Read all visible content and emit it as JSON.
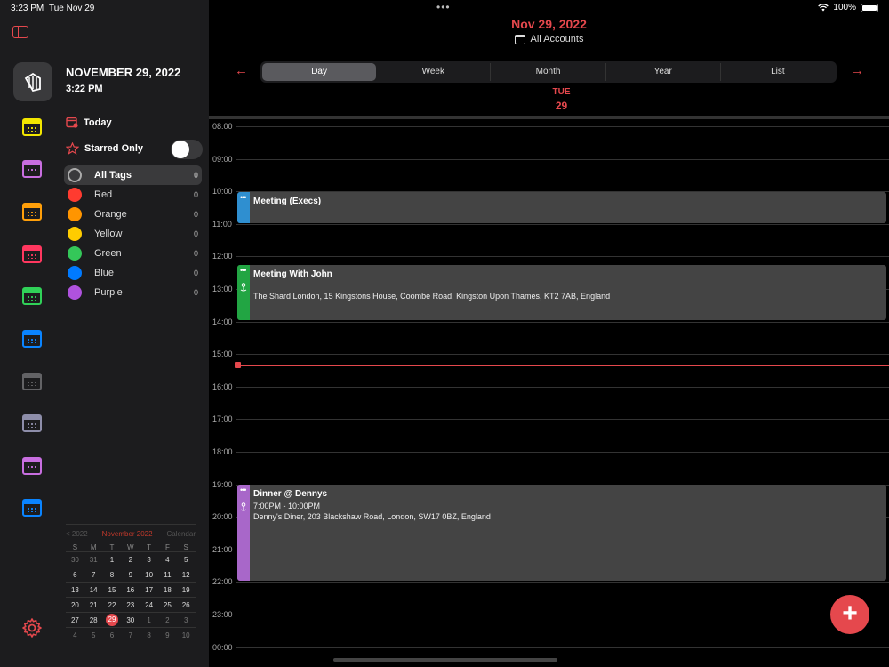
{
  "status": {
    "time": "3:23 PM",
    "date": "Tue Nov 29",
    "battery": "100%",
    "battery_level": 1.0
  },
  "sidebar": {
    "date": "NOVEMBER 29, 2022",
    "time": "3:22 PM",
    "today_label": "Today",
    "starred_label": "Starred Only",
    "starred_on": false,
    "rail_colors": [
      "#f2e600",
      "#c86ee0",
      "#ff9f0a",
      "#ff375f",
      "#30d158",
      "#0a84ff",
      "#636366",
      "#8e8eaa",
      "#c86ee0",
      "#0a84ff"
    ],
    "tags": [
      {
        "label": "All Tags",
        "count": "0",
        "color": ""
      },
      {
        "label": "Red",
        "count": "0",
        "color": "#ff3b30"
      },
      {
        "label": "Orange",
        "count": "0",
        "color": "#ff9500"
      },
      {
        "label": "Yellow",
        "count": "0",
        "color": "#ffcc00"
      },
      {
        "label": "Green",
        "count": "0",
        "color": "#34c759"
      },
      {
        "label": "Blue",
        "count": "0",
        "color": "#007aff"
      },
      {
        "label": "Purple",
        "count": "0",
        "color": "#af52de"
      }
    ],
    "mini_cal": {
      "prev": "< 2022",
      "month": "November 2022",
      "next": "Calendar",
      "dow": [
        "S",
        "M",
        "T",
        "W",
        "T",
        "F",
        "S"
      ],
      "weeks": [
        [
          "30",
          "31",
          "1",
          "2",
          "3",
          "4",
          "5"
        ],
        [
          "6",
          "7",
          "8",
          "9",
          "10",
          "11",
          "12"
        ],
        [
          "13",
          "14",
          "15",
          "16",
          "17",
          "18",
          "19"
        ],
        [
          "20",
          "21",
          "22",
          "23",
          "24",
          "25",
          "26"
        ],
        [
          "27",
          "28",
          "29",
          "30",
          "1",
          "2",
          "3"
        ],
        [
          "4",
          "5",
          "6",
          "7",
          "8",
          "9",
          "10"
        ]
      ],
      "selected": "29"
    }
  },
  "header": {
    "title": "Nov 29, 2022",
    "accounts": "All Accounts",
    "prev_arrow": "←",
    "next_arrow": "→",
    "views": [
      "Day",
      "Week",
      "Month",
      "Year",
      "List"
    ],
    "active_view": "Day",
    "day_name": "TUE",
    "day_number": "29"
  },
  "hours": [
    "08:00",
    "09:00",
    "10:00",
    "11:00",
    "12:00",
    "13:00",
    "14:00",
    "15:00",
    "16:00",
    "17:00",
    "18:00",
    "19:00",
    "20:00",
    "21:00",
    "22:00",
    "23:00",
    "00:00"
  ],
  "events": [
    {
      "title": "Meeting (Execs)",
      "detail": "",
      "location": "",
      "color": "#2f8fd0"
    },
    {
      "title": "Meeting With John",
      "detail": "",
      "location": "The Shard London, 15 Kingstons House, Coombe Road, Kingston Upon Thames, KT2 7AB, England",
      "color": "#22a543"
    },
    {
      "title": "Dinner @ Dennys",
      "detail": "7:00PM - 10:00PM",
      "location": "Denny's Diner, 203 Blackshaw Road, London, SW17 0BZ, England",
      "color": "#a867c9"
    }
  ],
  "fab_label": "+"
}
